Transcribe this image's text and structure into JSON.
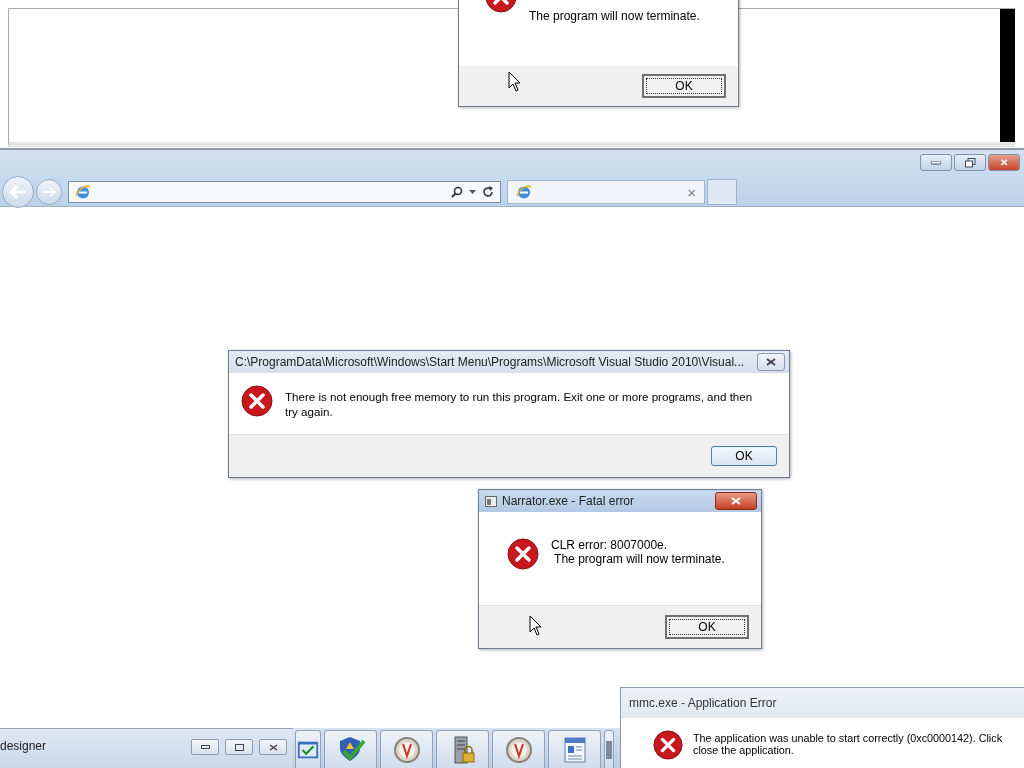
{
  "background_window": {
    "dialog": {
      "message": "The program will now terminate.",
      "button": {
        "label": "OK",
        "focused": true
      }
    }
  },
  "browser": {
    "window_buttons": {
      "close": "✕"
    },
    "tab": {
      "close": "×"
    }
  },
  "dialogs": [
    {
      "title": "C:\\ProgramData\\Microsoft\\Windows\\Start Menu\\Programs\\Microsoft Visual Studio 2010\\Visual...",
      "active": false,
      "lines": [
        "There is not enough free memory to run this program. Exit one or more programs, and then try again."
      ],
      "button": {
        "label": "OK",
        "focused": false
      }
    },
    {
      "title": "Narrator.exe - Fatal error",
      "active": true,
      "lines": [
        "CLR error: 8007000e.",
        " The program will now terminate."
      ],
      "button": {
        "label": "OK",
        "focused": true
      }
    }
  ],
  "designer_window": {
    "title": "designer"
  },
  "taskbar": [
    {
      "kind": "window"
    },
    {
      "kind": "security"
    },
    {
      "kind": "dial"
    },
    {
      "kind": "server"
    },
    {
      "kind": "dial"
    },
    {
      "kind": "document"
    },
    {
      "kind": "partial"
    }
  ],
  "mmc_dialog": {
    "title": "mmc.exe - Application Error",
    "lines": [
      "The application was unable to start correctly (0xc0000142). Click",
      "close the application."
    ]
  }
}
